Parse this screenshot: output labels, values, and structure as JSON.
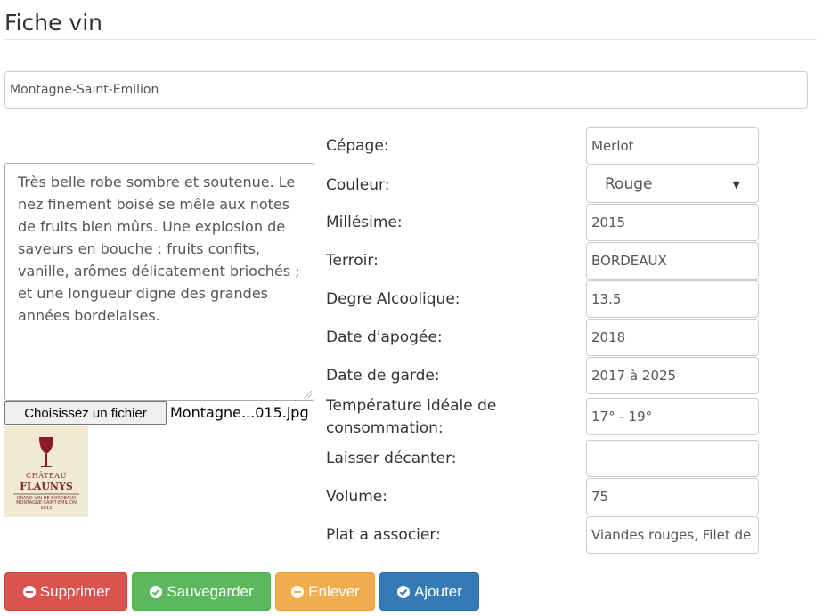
{
  "page": {
    "title": "Fiche vin"
  },
  "wine": {
    "name": "Montagne-Saint-Emilion",
    "description": "Très belle robe sombre et soutenue. Le nez finement boisé se mêle aux notes de fruits bien mûrs. Une explosion de saveurs en bouche : fruits confits, vanille, arômes délicatement briochés ; et une longueur digne des grandes années bordelaises.",
    "file_button": "Choisissez un fichier",
    "file_name": "Montagne...015.jpg",
    "label_brand_line1": "CHÂTEAU",
    "label_brand_line2": "FLAUNYS",
    "label_brand_line3": "GRAND VIN DE BORDEAUX",
    "label_brand_line4": "MONTAGNE-SAINT-EMILION",
    "label_brand_year": "2015"
  },
  "fields": [
    {
      "label": "Cépage:",
      "value": "Merlot"
    },
    {
      "label": "Couleur:",
      "value": "Rouge"
    },
    {
      "label": "Millésime:",
      "value": "2015"
    },
    {
      "label": "Terroir:",
      "value": "BORDEAUX"
    },
    {
      "label": "Degre Alcoolique:",
      "value": "13.5"
    },
    {
      "label": "Date d'apogée:",
      "value": "2018"
    },
    {
      "label": "Date de garde:",
      "value": "2017 à 2025"
    },
    {
      "label": "Température idéale de consommation:",
      "value": "17° - 19°"
    },
    {
      "label": "Laisser décanter:",
      "value": ""
    },
    {
      "label": "Volume:",
      "value": "75"
    },
    {
      "label": "Plat a associer:",
      "value": "Viandes rouges, Filet de"
    }
  ],
  "buttons": {
    "delete": "Supprimer",
    "save": "Sauvegarder",
    "remove": "Enlever",
    "add": "Ajouter"
  },
  "colors": {
    "danger": "#d9534f",
    "success": "#5cb85c",
    "warning": "#f0ad4e",
    "primary": "#337ab7"
  }
}
